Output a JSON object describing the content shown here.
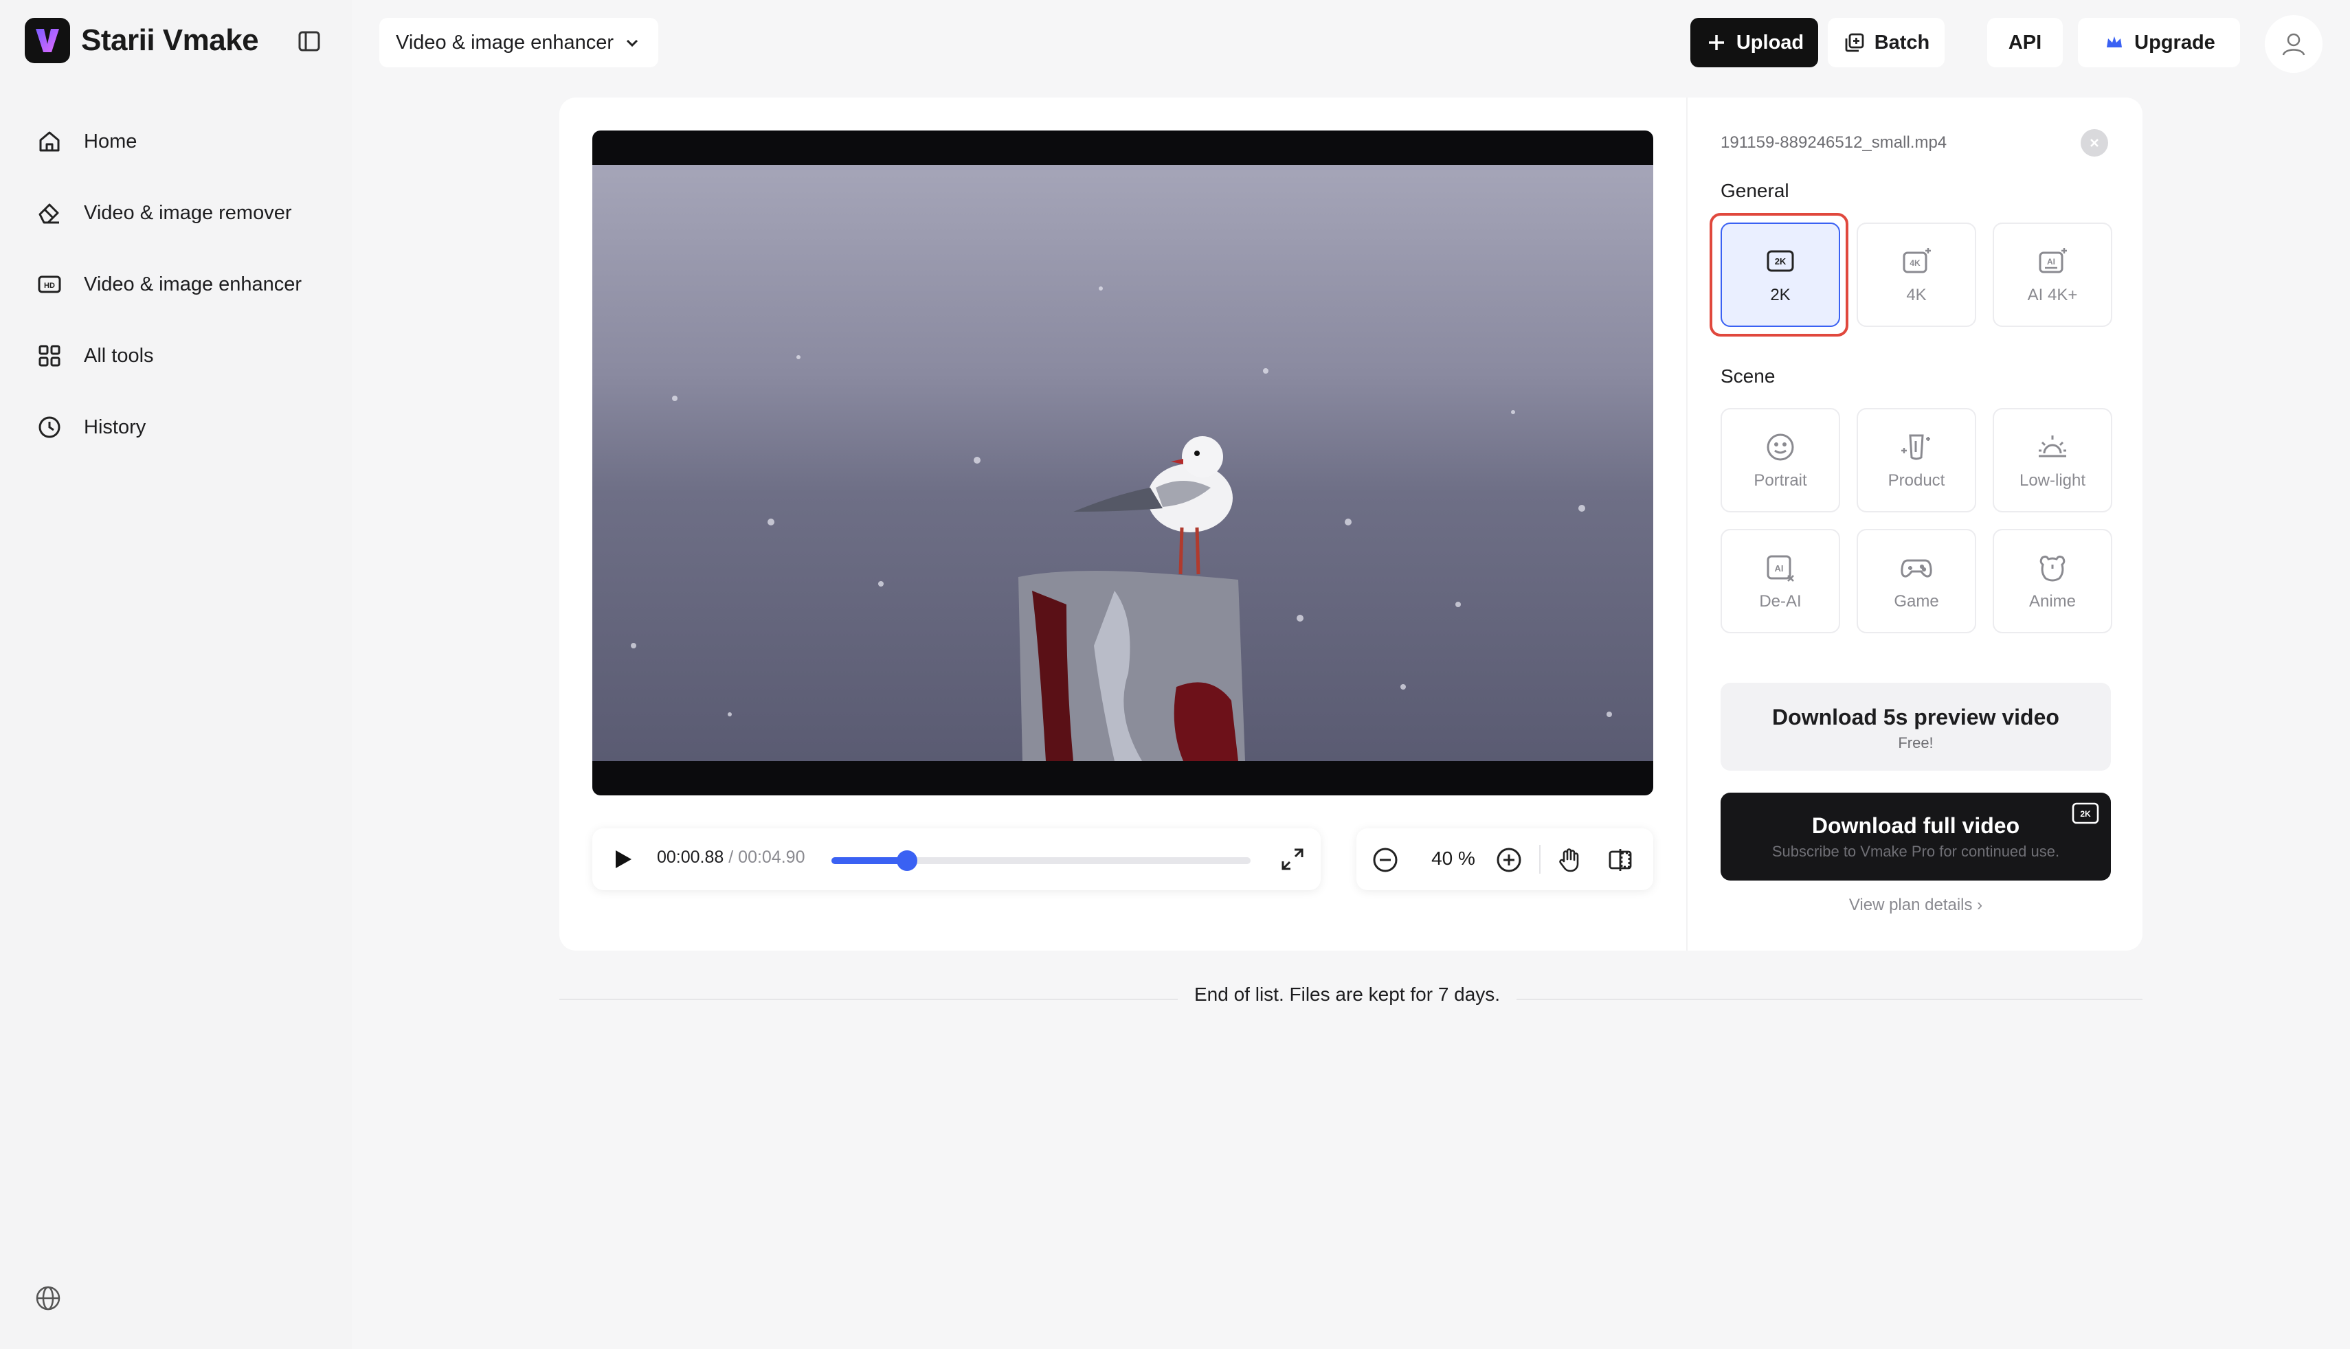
{
  "brand": {
    "name": "Starii Vmake"
  },
  "sidebar": {
    "items": [
      {
        "label": "Home",
        "icon": "home-icon"
      },
      {
        "label": "Video & image remover",
        "icon": "eraser-icon"
      },
      {
        "label": "Video & image enhancer",
        "icon": "hd-icon"
      },
      {
        "label": "All tools",
        "icon": "grid-icon"
      },
      {
        "label": "History",
        "icon": "clock-icon"
      }
    ]
  },
  "header": {
    "tool_select": "Video & image enhancer",
    "upload_label": "Upload",
    "batch_label": "Batch",
    "api_label": "API",
    "upgrade_label": "Upgrade"
  },
  "player": {
    "current_time": "00:00.88",
    "duration": "/ 00:04.90",
    "progress": 0.18,
    "zoom": "40 %"
  },
  "panel": {
    "filename": "191159-889246512_small.mp4",
    "general_label": "General",
    "general_options": [
      {
        "label": "2K",
        "icon": "2k-icon",
        "selected": true
      },
      {
        "label": "4K",
        "icon": "4k-icon",
        "selected": false
      },
      {
        "label": "AI 4K+",
        "icon": "ai-ultra-icon",
        "selected": false
      }
    ],
    "scene_label": "Scene",
    "scene_options": [
      {
        "label": "Portrait",
        "icon": "smile-icon"
      },
      {
        "label": "Product",
        "icon": "product-icon"
      },
      {
        "label": "Low-light",
        "icon": "sunrise-icon"
      },
      {
        "label": "De-AI",
        "icon": "de-ai-icon"
      },
      {
        "label": "Game",
        "icon": "gamepad-icon"
      },
      {
        "label": "Anime",
        "icon": "bear-icon"
      }
    ],
    "preview_title": "Download 5s preview video",
    "preview_sub": "Free!",
    "full_title": "Download full video",
    "full_sub": "Subscribe to Vmake Pro for continued use.",
    "plan_link": "View plan details ›"
  },
  "footer": {
    "end_text": "End of list. Files are kept for 7 days."
  },
  "colors": {
    "accent": "#3a61f3",
    "highlight": "#e0483d",
    "dark": "#161618"
  }
}
